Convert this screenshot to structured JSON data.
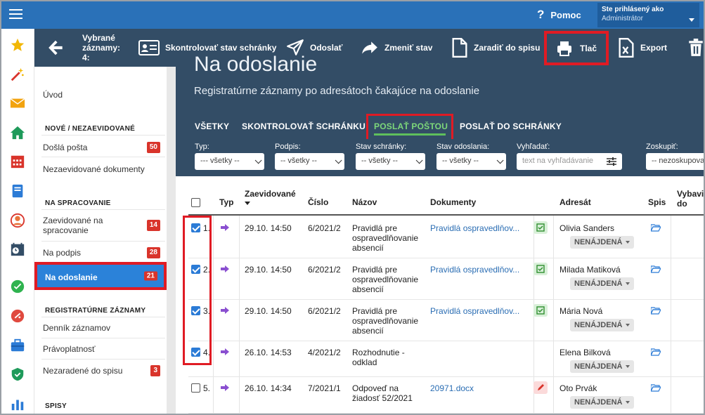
{
  "topbar": {
    "help_label": "Pomoc",
    "user_caption": "Ste prihlásený ako",
    "user_name": "Administrátor"
  },
  "toolbar": {
    "selected_label": "Vybrané",
    "selected_label2": "záznamy:",
    "selected_count": "4:",
    "check_mailbox": "Skontrolovať stav schránky",
    "send": "Odoslať",
    "change_state": "Zmeniť stav",
    "file_to_folder": "Zaradiť do spisu",
    "print": "Tlač",
    "export": "Export"
  },
  "sidebar": {
    "intro": "Úvod",
    "section_new": "NOVÉ / NEZAEVIDOVANÉ",
    "incoming": "Došlá pošta",
    "incoming_count": "50",
    "unregistered": "Nezaevidované dokumenty",
    "section_processing": "NA SPRACOVANIE",
    "registered_line1": "Zaevidované na",
    "registered_line2": "spracovanie",
    "registered_count": "14",
    "to_sign": "Na podpis",
    "to_sign_count": "28",
    "to_send": "Na odoslanie",
    "to_send_count": "21",
    "section_records": "REGISTRATÚRNE ZÁZNAMY",
    "journal": "Denník záznamov",
    "validity": "Právoplatnosť",
    "unfiled": "Nezaradené do spisu",
    "unfiled_count": "3",
    "section_files": "SPISY"
  },
  "page": {
    "title": "Na odoslanie",
    "subtitle": "Registratúrne záznamy po adresátoch čakajúce na odoslanie"
  },
  "tabs": {
    "all": "VŠETKY",
    "check": "SKONTROLOVAŤ SCHRÁNKU",
    "post": "POSLAŤ POŠTOU",
    "mailbox": "POSLAŤ DO SCHRÁNKY"
  },
  "filters": {
    "type_label": "Typ:",
    "type_value": "--- všetky --",
    "sign_label": "Podpis:",
    "sign_value": "-- všetky --",
    "mailbox_label": "Stav schránky:",
    "mailbox_value": "-- všetky --",
    "send_label": "Stav odoslania:",
    "send_value": "-- všetky --",
    "search_label": "Vyhľadať:",
    "search_placeholder": "text na vyhľadávanie",
    "group_label": "Zoskupiť:",
    "group_value": "-- nezoskupovať --"
  },
  "table": {
    "headers": {
      "type": "Typ",
      "registered": "Zaevidované",
      "number": "Číslo",
      "name": "Názov",
      "documents": "Dokumenty",
      "addressee": "Adresát",
      "file": "Spis",
      "handled1": "Vybaviť",
      "handled2": "do"
    },
    "rows": [
      {
        "idx": "1.",
        "date": "29.10. 14:50",
        "number": "6/2021/2",
        "name1": "Pravidlá pre",
        "name2": "ospravedlňovanie",
        "name3": "absencií",
        "doc": "Pravidlá ospravedlňov...",
        "addressee": "Olivia Sanders",
        "status": "NENÁJDENÁ"
      },
      {
        "idx": "2.",
        "date": "29.10. 14:50",
        "number": "6/2021/2",
        "name1": "Pravidlá pre",
        "name2": "ospravedlňovanie",
        "name3": "absencií",
        "doc": "Pravidlá ospravedlňov...",
        "addressee": "Milada Matiková",
        "status": "NENÁJDENÁ"
      },
      {
        "idx": "3.",
        "date": "29.10. 14:50",
        "number": "6/2021/2",
        "name1": "Pravidlá pre",
        "name2": "ospravedlňovanie",
        "name3": "absencií",
        "doc": "Pravidlá ospravedlňov...",
        "addressee": "Mária Nová",
        "status": "NENÁJDENÁ"
      },
      {
        "idx": "4.",
        "date": "26.10. 14:53",
        "number": "4/2021/2",
        "name1": "Rozhodnutie -",
        "name2": "odklad",
        "name3": "",
        "doc": "",
        "addressee": "Elena Bilková",
        "status": "NENÁJDENÁ"
      },
      {
        "idx": "5.",
        "date": "26.10. 14:34",
        "number": "7/2021/1",
        "name1": "Odpoveď na",
        "name2": "žiadosť 52/2021",
        "name3": "",
        "doc": "20971.docx",
        "addressee": "Oto Prvák",
        "status": "NENÁJDENÁ"
      }
    ]
  },
  "colors": {
    "topbar": "#2a71b8",
    "toolbar": "#334d66",
    "active": "#2b82d9",
    "highlight": "#e01b24",
    "badge": "#d9342b"
  }
}
